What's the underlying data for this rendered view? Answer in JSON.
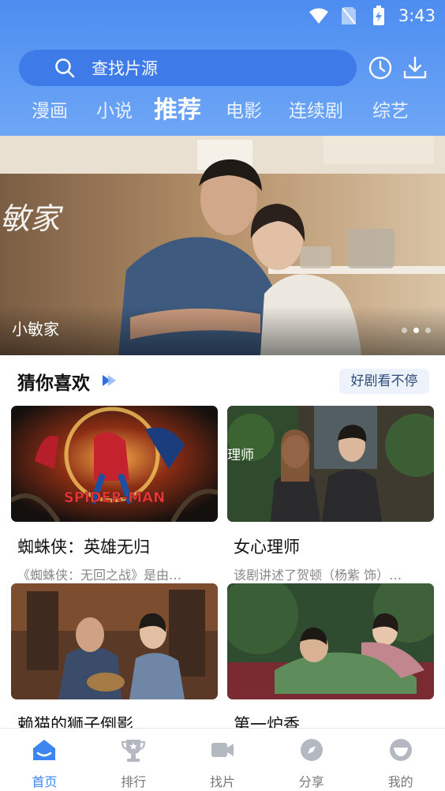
{
  "status_bar": {
    "time": "3:43"
  },
  "header": {
    "search_placeholder": "查找片源",
    "tabs": [
      {
        "label": "漫画",
        "active": false
      },
      {
        "label": "小说",
        "active": false
      },
      {
        "label": "推荐",
        "active": true
      },
      {
        "label": "电影",
        "active": false
      },
      {
        "label": "连续剧",
        "active": false
      },
      {
        "label": "综艺",
        "active": false
      }
    ]
  },
  "banner": {
    "title": "小敏家",
    "overlay_text": "敏家",
    "slide_count": 3,
    "active_slide": 1
  },
  "section": {
    "title": "猜你喜欢",
    "more_label": "好剧看不停"
  },
  "cards": [
    {
      "title": "蜘蛛侠：英雄无归",
      "desc": "《蜘蛛侠：无回之战》是由…",
      "poster_text": "SPIDER-MAN"
    },
    {
      "title": "女心理师",
      "desc": "该剧讲述了贺顿（杨紫 饰）…",
      "poster_text": "理师"
    },
    {
      "title": "赖猫的狮子倒影",
      "desc": ""
    },
    {
      "title": "第一炉香",
      "desc": ""
    }
  ],
  "bottom_nav": [
    {
      "label": "首页",
      "icon": "home-icon",
      "active": true
    },
    {
      "label": "排行",
      "icon": "trophy-icon",
      "active": false
    },
    {
      "label": "找片",
      "icon": "video-camera-icon",
      "active": false
    },
    {
      "label": "分享",
      "icon": "compass-icon",
      "active": false
    },
    {
      "label": "我的",
      "icon": "profile-icon",
      "active": false
    }
  ],
  "colors": {
    "header_top": "#4d8df0",
    "header_bottom": "#6ea6f6",
    "search_bg": "#3f7be8",
    "nav_active": "#3b86f0",
    "nav_inactive": "#777777"
  }
}
